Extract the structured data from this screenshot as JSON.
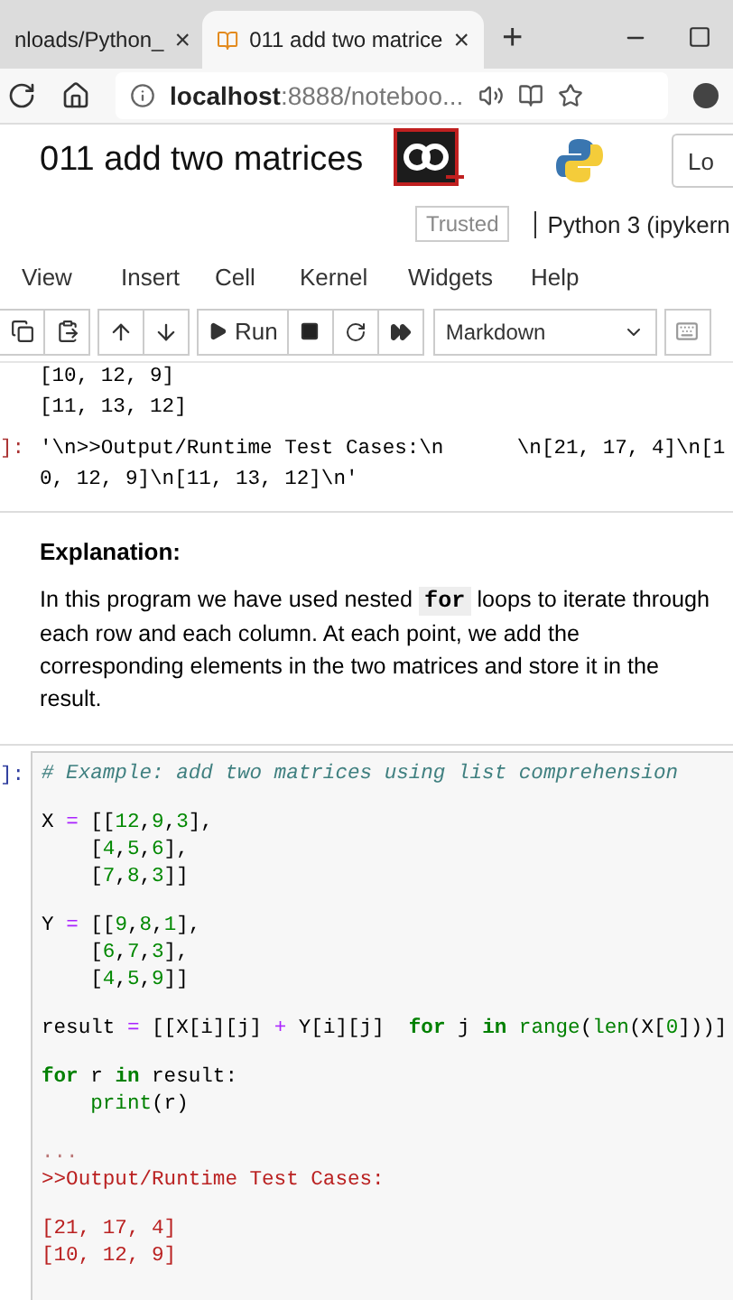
{
  "browser": {
    "tabs": [
      {
        "title": "nloads/Python_",
        "close": "×",
        "selected": false
      },
      {
        "title": "011 add two matrice",
        "close": "×",
        "selected": true
      }
    ],
    "new_tab": "+",
    "address": {
      "host": "localhost",
      "rest": ":8888/noteboo..."
    }
  },
  "notebook": {
    "title": "011 add two matrices",
    "login": "Lo",
    "trusted": "Trusted",
    "kernel": "Python 3 (ipykern",
    "menu": [
      "View",
      "Insert",
      "Cell",
      "Kernel",
      "Widgets",
      "Help"
    ],
    "run_label": "Run",
    "cell_type": "Markdown"
  },
  "cells": [
    {
      "kind": "output",
      "lines": [
        "[10, 12, 9]",
        "[11, 13, 12]"
      ]
    },
    {
      "kind": "result",
      "prompt": "]:",
      "lines": [
        "'\\n>>Output/Runtime Test Cases:\\n      \\n[21, 17, 4]\\n[1",
        "0, 12, 9]\\n[11, 13, 12]\\n'"
      ]
    },
    {
      "kind": "markdown",
      "heading": "Explanation:",
      "before": "In this program we have used nested ",
      "code": "for",
      "after": " loops to iterate through each row and each column. At each point, we add the corresponding elements in the two matrices and store it in the result."
    },
    {
      "kind": "code",
      "prompt": "]:",
      "lines": [
        {
          "space_before": false,
          "indent": false,
          "segments": [
            {
              "text": "# Example: add two matrices using list comprehension",
              "kind": "comment"
            }
          ]
        },
        {
          "space_before": true,
          "indent": false,
          "segments": [
            {
              "text": "X ",
              "kind": "plain"
            },
            {
              "text": "=",
              "kind": "operator"
            },
            {
              "text": " [[",
              "kind": "plain"
            },
            {
              "text": "12",
              "kind": "number"
            },
            {
              "text": ",",
              "kind": "plain"
            },
            {
              "text": "9",
              "kind": "number"
            },
            {
              "text": ",",
              "kind": "plain"
            },
            {
              "text": "3",
              "kind": "number"
            },
            {
              "text": "],",
              "kind": "plain"
            }
          ]
        },
        {
          "space_before": false,
          "indent": true,
          "segments": [
            {
              "text": "[",
              "kind": "plain"
            },
            {
              "text": "4",
              "kind": "number"
            },
            {
              "text": ",",
              "kind": "plain"
            },
            {
              "text": "5",
              "kind": "number"
            },
            {
              "text": ",",
              "kind": "plain"
            },
            {
              "text": "6",
              "kind": "number"
            },
            {
              "text": "],",
              "kind": "plain"
            }
          ]
        },
        {
          "space_before": false,
          "indent": true,
          "segments": [
            {
              "text": "[",
              "kind": "plain"
            },
            {
              "text": "7",
              "kind": "number"
            },
            {
              "text": ",",
              "kind": "plain"
            },
            {
              "text": "8",
              "kind": "number"
            },
            {
              "text": ",",
              "kind": "plain"
            },
            {
              "text": "3",
              "kind": "number"
            },
            {
              "text": "]]",
              "kind": "plain"
            }
          ]
        },
        {
          "space_before": true,
          "indent": false,
          "segments": [
            {
              "text": "Y ",
              "kind": "plain"
            },
            {
              "text": "=",
              "kind": "operator"
            },
            {
              "text": " [[",
              "kind": "plain"
            },
            {
              "text": "9",
              "kind": "number"
            },
            {
              "text": ",",
              "kind": "plain"
            },
            {
              "text": "8",
              "kind": "number"
            },
            {
              "text": ",",
              "kind": "plain"
            },
            {
              "text": "1",
              "kind": "number"
            },
            {
              "text": "],",
              "kind": "plain"
            }
          ]
        },
        {
          "space_before": false,
          "indent": true,
          "segments": [
            {
              "text": "[",
              "kind": "plain"
            },
            {
              "text": "6",
              "kind": "number"
            },
            {
              "text": ",",
              "kind": "plain"
            },
            {
              "text": "7",
              "kind": "number"
            },
            {
              "text": ",",
              "kind": "plain"
            },
            {
              "text": "3",
              "kind": "number"
            },
            {
              "text": "],",
              "kind": "plain"
            }
          ]
        },
        {
          "space_before": false,
          "indent": true,
          "segments": [
            {
              "text": "[",
              "kind": "plain"
            },
            {
              "text": "4",
              "kind": "number"
            },
            {
              "text": ",",
              "kind": "plain"
            },
            {
              "text": "5",
              "kind": "number"
            },
            {
              "text": ",",
              "kind": "plain"
            },
            {
              "text": "9",
              "kind": "number"
            },
            {
              "text": "]]",
              "kind": "plain"
            }
          ]
        },
        {
          "space_before": true,
          "indent": false,
          "segments": [
            {
              "text": "result ",
              "kind": "plain"
            },
            {
              "text": "=",
              "kind": "operator"
            },
            {
              "text": " [[X[i][j] ",
              "kind": "plain"
            },
            {
              "text": "+",
              "kind": "operator"
            },
            {
              "text": " Y[i][j]  ",
              "kind": "plain"
            },
            {
              "text": "for",
              "kind": "keyword"
            },
            {
              "text": " j ",
              "kind": "plain"
            },
            {
              "text": "in",
              "kind": "keyword"
            },
            {
              "text": " range",
              "kind": "builtin"
            },
            {
              "text": "(",
              "kind": "plain"
            },
            {
              "text": "len",
              "kind": "builtin"
            },
            {
              "text": "(X[",
              "kind": "plain"
            },
            {
              "text": "0",
              "kind": "number"
            },
            {
              "text": "]))]",
              "kind": "plain"
            }
          ]
        },
        {
          "space_before": true,
          "indent": false,
          "segments": [
            {
              "text": "for",
              "kind": "keyword"
            },
            {
              "text": " r ",
              "kind": "plain"
            },
            {
              "text": "in",
              "kind": "keyword"
            },
            {
              "text": " result:",
              "kind": "plain"
            }
          ]
        },
        {
          "space_before": false,
          "indent": true,
          "segments": [
            {
              "text": "print",
              "kind": "builtin"
            },
            {
              "text": "(r)",
              "kind": "plain"
            }
          ]
        },
        {
          "space_before": true,
          "indent": false,
          "segments": [
            {
              "text": "...",
              "kind": "muted"
            }
          ]
        },
        {
          "space_before": false,
          "indent": false,
          "segments": [
            {
              "text": ">>Output/Runtime Test Cases:",
              "kind": "string"
            }
          ]
        },
        {
          "space_before": true,
          "indent": false,
          "segments": [
            {
              "text": "[21, 17, 4]",
              "kind": "string"
            }
          ]
        },
        {
          "space_before": false,
          "indent": false,
          "segments": [
            {
              "text": "[10, 12, 9]",
              "kind": "string"
            }
          ]
        }
      ]
    }
  ]
}
